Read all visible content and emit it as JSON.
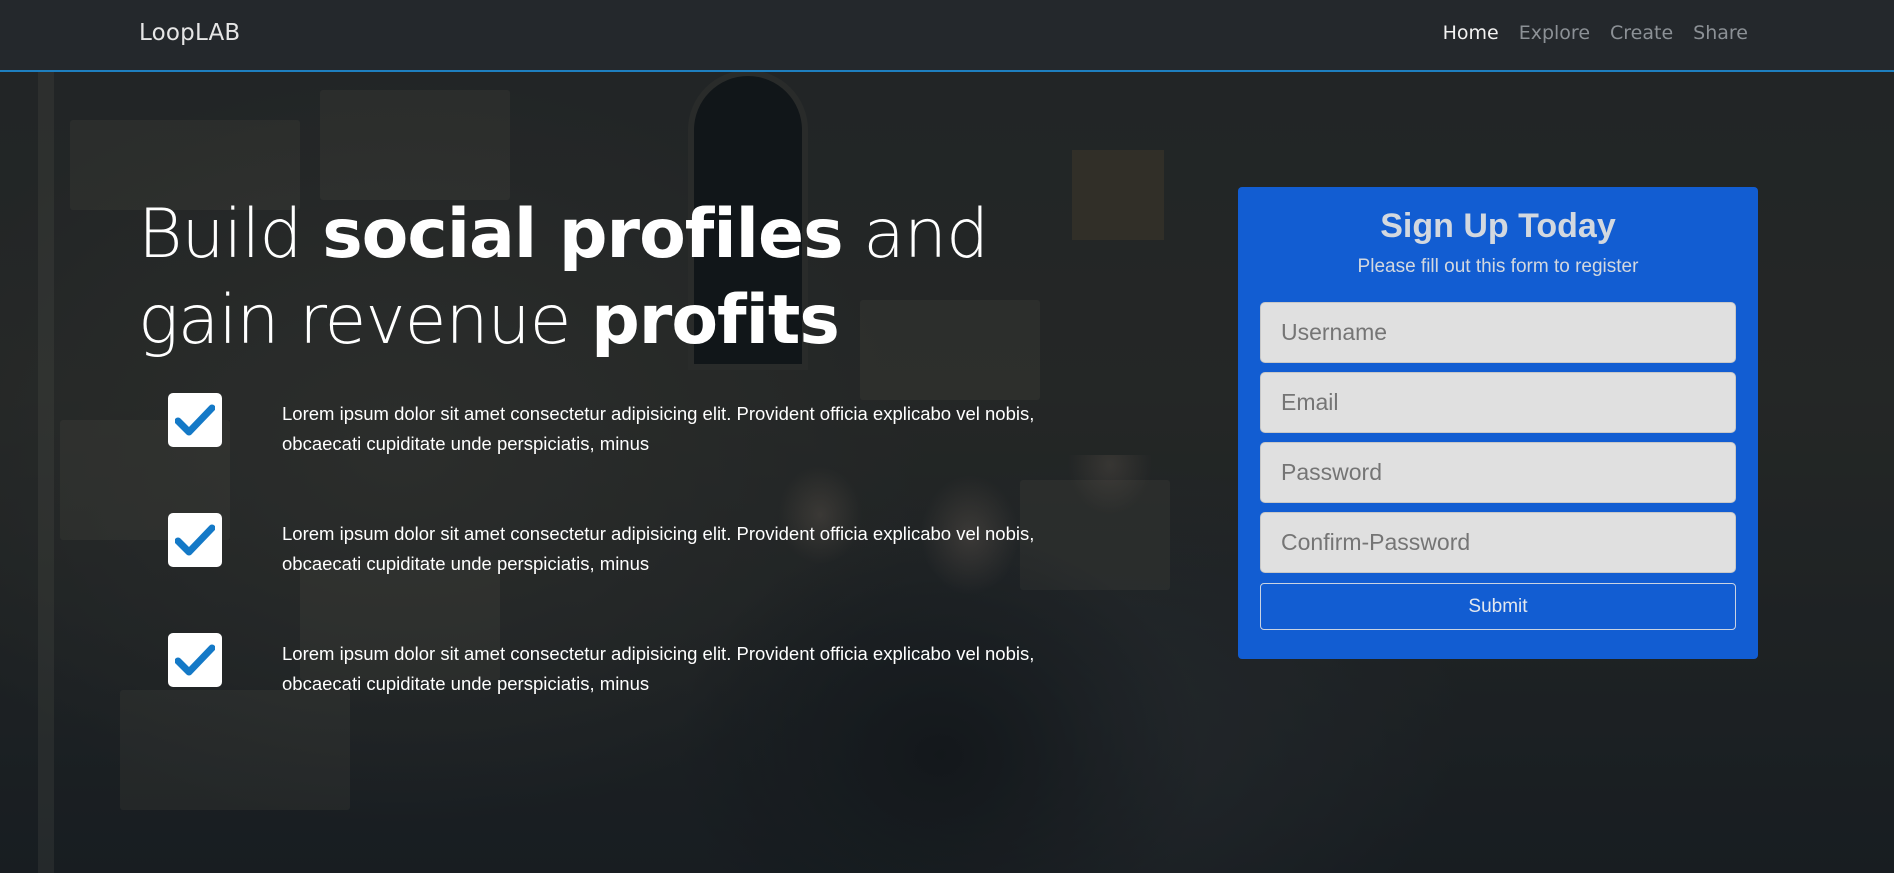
{
  "navbar": {
    "brand": "LoopLAB",
    "links": [
      {
        "label": "Home",
        "active": true
      },
      {
        "label": "Explore",
        "active": false
      },
      {
        "label": "Create",
        "active": false
      },
      {
        "label": "Share",
        "active": false
      }
    ]
  },
  "hero": {
    "part1": "Build ",
    "bold1": "social profiles",
    "part2": " and gain revenue ",
    "bold2": "profits"
  },
  "features": [
    {
      "icon": "check-icon",
      "text": "Lorem ipsum dolor sit amet consectetur adipisicing elit. Provident officia explicabo vel nobis, obcaecati cupiditate unde perspiciatis, minus"
    },
    {
      "icon": "check-icon",
      "text": "Lorem ipsum dolor sit amet consectetur adipisicing elit. Provident officia explicabo vel nobis, obcaecati cupiditate unde perspiciatis, minus"
    },
    {
      "icon": "check-icon",
      "text": "Lorem ipsum dolor sit amet consectetur adipisicing elit. Provident officia explicabo vel nobis, obcaecati cupiditate unde perspiciatis, minus"
    }
  ],
  "signup": {
    "title": "Sign Up Today",
    "subtitle": "Please fill out this form to register",
    "fields": [
      {
        "placeholder": "Username"
      },
      {
        "placeholder": "Email"
      },
      {
        "placeholder": "Password"
      },
      {
        "placeholder": "Confirm-Password"
      }
    ],
    "submit_label": "Submit"
  },
  "colors": {
    "accent": "#1162e0",
    "navbar_border": "#1e7fbf",
    "check": "#1479c7"
  }
}
